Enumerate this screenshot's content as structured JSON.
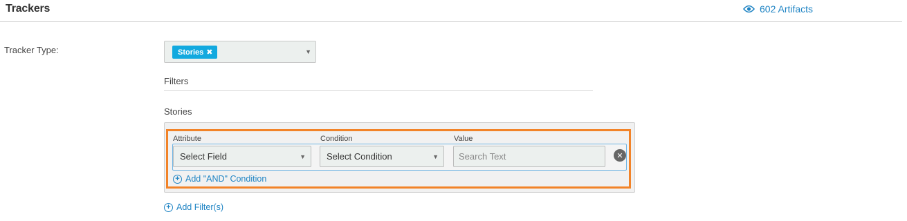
{
  "header": {
    "title": "Trackers",
    "artifacts_icon": "eye-icon",
    "artifacts_label": "602 Artifacts"
  },
  "tracker_type": {
    "label": "Tracker Type:",
    "selected_chip": "Stories",
    "chip_remove_icon": "close-x-icon"
  },
  "filters": {
    "label": "Filters",
    "group_label": "Stories",
    "columns": {
      "attribute": "Attribute",
      "condition": "Condition",
      "value": "Value"
    },
    "row": {
      "attribute_selected": "Select Field",
      "condition_selected": "Select Condition",
      "value_placeholder": "Search Text",
      "value": ""
    },
    "add_and_condition": "Add \"AND\" Condition",
    "add_filters": "Add Filter(s)"
  },
  "colors": {
    "accent_link": "#1f84c4",
    "chip_bg": "#12a9df",
    "highlight_border": "#f28328"
  }
}
